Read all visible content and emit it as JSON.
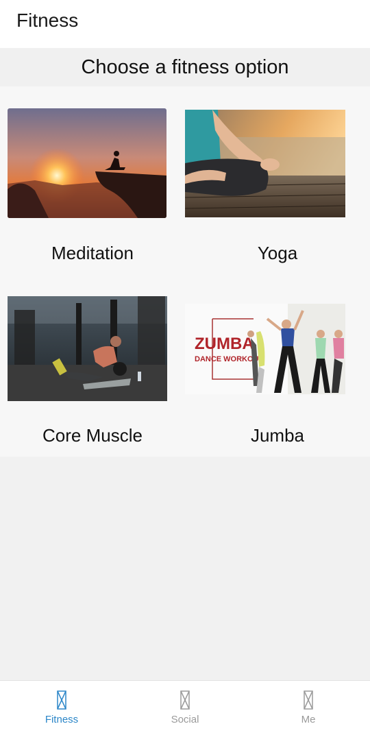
{
  "app_bar": {
    "title": "Fitness"
  },
  "section": {
    "title": "Choose a fitness option"
  },
  "options": [
    {
      "label": "Meditation",
      "image": "sunset-meditation-cliff-image"
    },
    {
      "label": "Yoga",
      "image": "lotus-pose-lake-image"
    },
    {
      "label": "Core Muscle",
      "image": "gym-core-workout-image"
    },
    {
      "label": "Jumba",
      "image": "zumba-dance-workout-image",
      "image_text": {
        "line1": "ZUMBA",
        "line2": "DANCE WORKOUT"
      }
    }
  ],
  "bottom_nav": {
    "items": [
      {
        "label": "Fitness",
        "active": true
      },
      {
        "label": "Social",
        "active": false
      },
      {
        "label": "Me",
        "active": false
      }
    ],
    "active_color": "#2b86c8",
    "inactive_color": "#9a9a9a"
  }
}
